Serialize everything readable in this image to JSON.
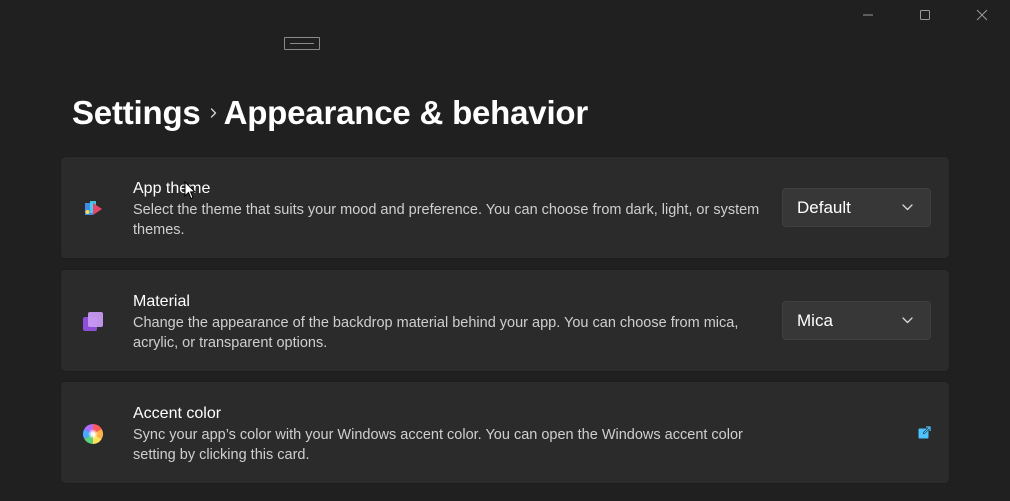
{
  "window": {
    "caption_buttons": [
      {
        "name": "minimize",
        "icon": "minimize-icon"
      },
      {
        "name": "maximize",
        "icon": "maximize-icon"
      },
      {
        "name": "close",
        "icon": "close-icon"
      }
    ]
  },
  "header": {
    "breadcrumb_root": "Settings",
    "breadcrumb_separator_icon": "chevron-right-icon",
    "breadcrumb_current": "Appearance & behavior"
  },
  "cards": [
    {
      "title": "App theme",
      "description": "Select the theme that suits your mood and preference. You can choose from dark, light, or system themes.",
      "icon": "palette-icon",
      "control": "dropdown",
      "value": "Default"
    },
    {
      "title": "Material",
      "description": "Change the appearance of the backdrop material behind your app. You can choose from mica, acrylic, or transparent options.",
      "icon": "layers-icon",
      "control": "dropdown",
      "value": "Mica"
    },
    {
      "title": "Accent color",
      "description": "Sync your app’s color with your Windows accent color. You can open the Windows accent color setting by clicking this card.",
      "icon": "color-wheel-icon",
      "control": "external-link",
      "link_icon": "open-external-icon"
    }
  ],
  "colors": {
    "background": "#202020",
    "card": "#2b2b2b",
    "dropdown": "#373737",
    "accent": "#4cc2ff",
    "text_primary": "#ffffff",
    "text_secondary": "#cfcfcf"
  }
}
